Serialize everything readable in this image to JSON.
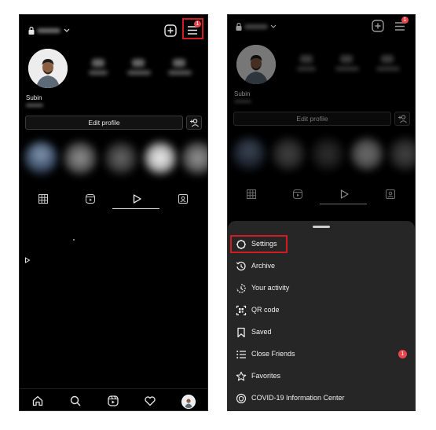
{
  "left": {
    "profile_name": "Subin",
    "edit_profile": "Edit profile",
    "menu_badge": "1"
  },
  "right": {
    "profile_name": "Subin",
    "edit_profile": "Edit profile",
    "menu_badge": "1",
    "menu": [
      {
        "label": "Settings",
        "icon": "settings-icon"
      },
      {
        "label": "Archive",
        "icon": "archive-icon"
      },
      {
        "label": "Your activity",
        "icon": "activity-icon"
      },
      {
        "label": "QR code",
        "icon": "qr-code-icon"
      },
      {
        "label": "Saved",
        "icon": "bookmark-icon"
      },
      {
        "label": "Close Friends",
        "icon": "list-icon",
        "badge": "1"
      },
      {
        "label": "Favorites",
        "icon": "star-icon"
      },
      {
        "label": "COVID-19 Information Center",
        "icon": "covid-info-icon"
      }
    ]
  },
  "colors": {
    "highlight_box": "#d21b24",
    "notification_badge": "#e8464e",
    "sheet_background": "#262626",
    "app_background": "#000000"
  }
}
